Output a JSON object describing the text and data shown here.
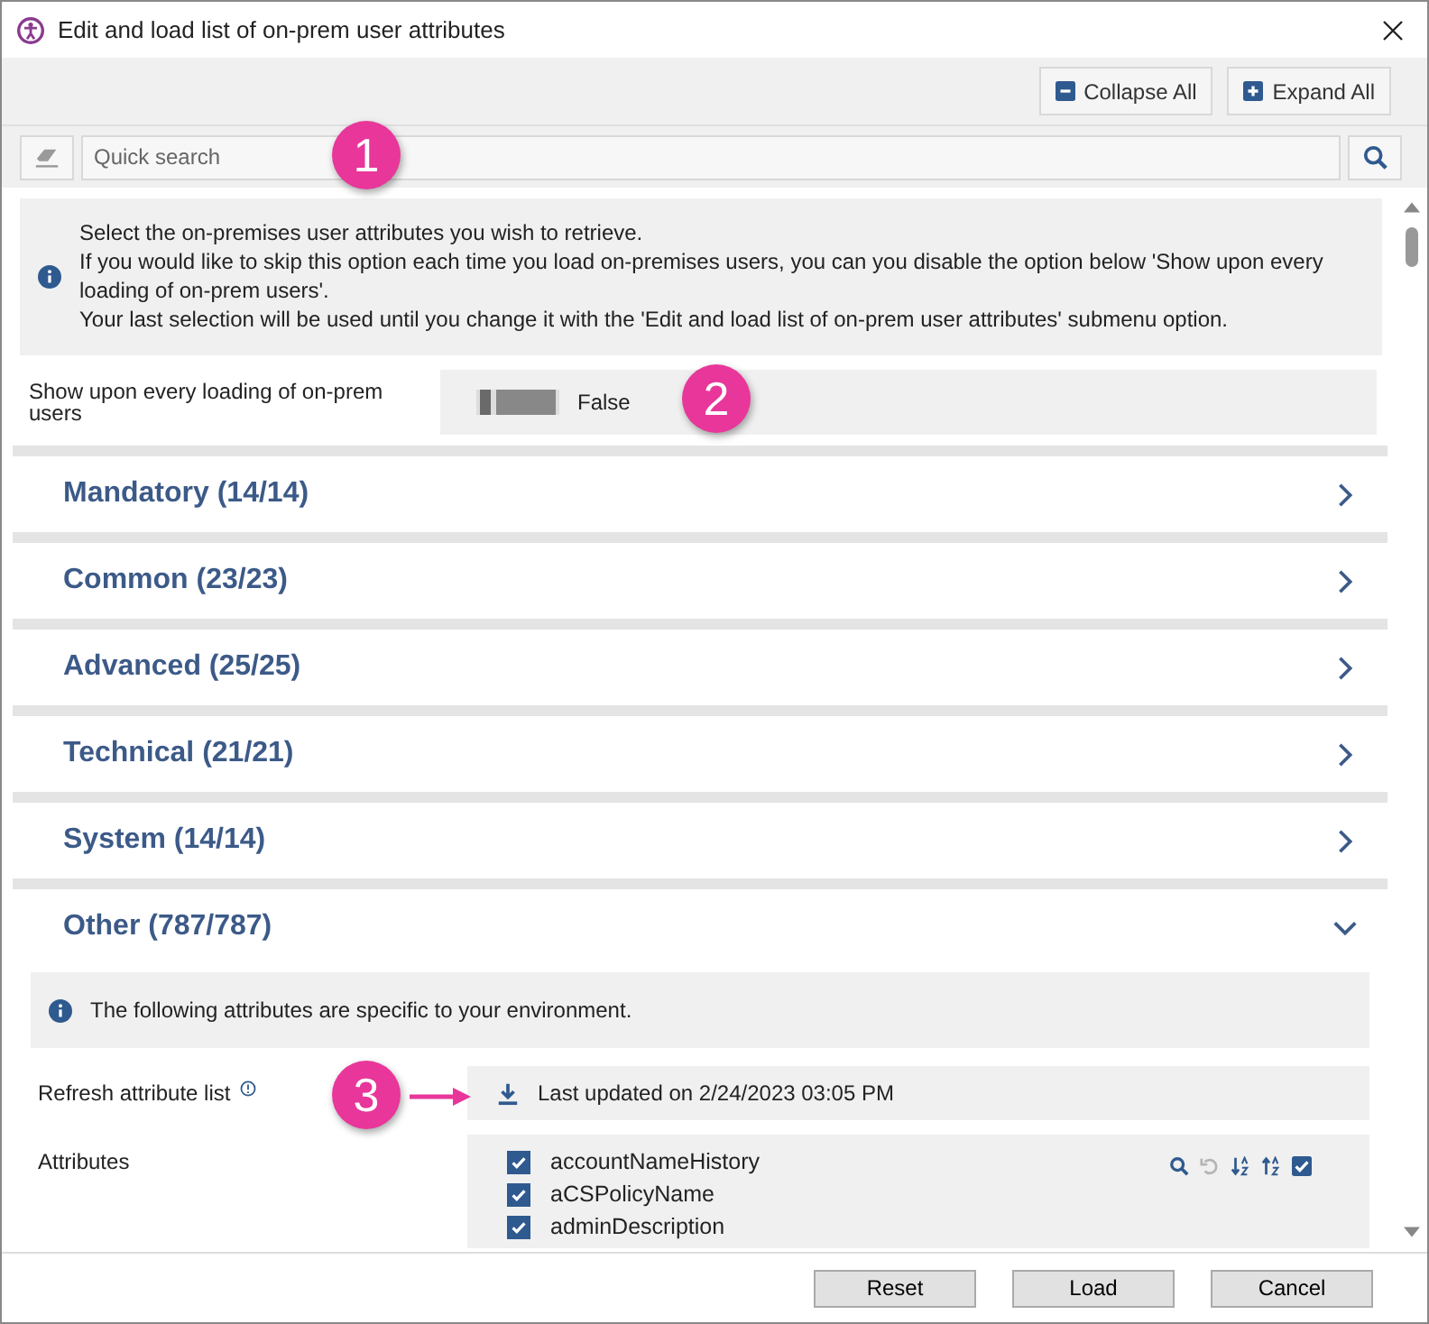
{
  "window": {
    "title": "Edit and load list of on-prem user attributes"
  },
  "toolbar": {
    "buttons": [
      {
        "label": "Collapse All",
        "kind": "collapse"
      },
      {
        "label": "Expand All",
        "kind": "expand"
      }
    ]
  },
  "search": {
    "placeholder": "Quick search"
  },
  "info": {
    "lines": [
      "Select the on-premises user attributes you wish to retrieve.",
      "If you would like to skip this option each time you load on-premises users, you can you disable the option below 'Show upon every loading of on-prem users'.",
      "Your last selection will be used until you change it with the 'Edit and load list of on-prem user attributes' submenu option."
    ]
  },
  "show_setting": {
    "label": "Show upon every loading of on-prem users",
    "on": false,
    "value": "False"
  },
  "sections": [
    {
      "title": "Mandatory (14/14)",
      "expanded": false
    },
    {
      "title": "Common (23/23)",
      "expanded": false
    },
    {
      "title": "Advanced (25/25)",
      "expanded": false
    },
    {
      "title": "Technical (21/21)",
      "expanded": false
    },
    {
      "title": "System (14/14)",
      "expanded": false
    },
    {
      "title": "Other (787/787)",
      "expanded": true
    }
  ],
  "other": {
    "info": "The following attributes are specific to your environment.",
    "refresh": {
      "label": "Refresh attribute list",
      "status": "Last updated on 2/24/2023 03:05 PM"
    },
    "attributes": {
      "label": "Attributes",
      "items": [
        {
          "name": "accountNameHistory",
          "checked": true
        },
        {
          "name": "aCSPolicyName",
          "checked": true
        },
        {
          "name": "adminDescription",
          "checked": true
        }
      ]
    }
  },
  "callouts": [
    "1",
    "2",
    "3"
  ],
  "buttons": [
    "Reset",
    "Load",
    "Cancel"
  ]
}
